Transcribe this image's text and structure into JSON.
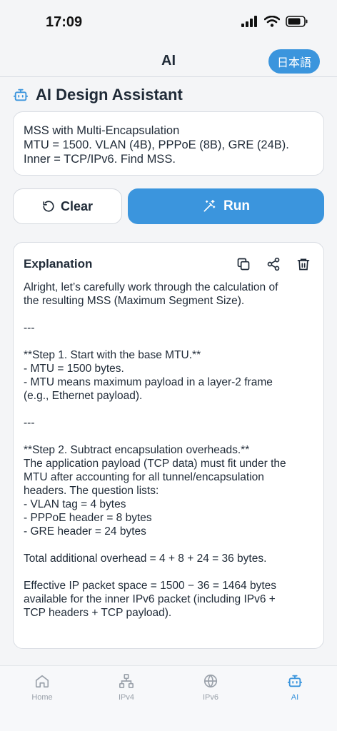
{
  "status": {
    "time": "17:09"
  },
  "nav": {
    "title": "AI",
    "lang_button": "日本語"
  },
  "section": {
    "title": "AI Design Assistant"
  },
  "prompt": {
    "lines": [
      "MSS with Multi-Encapsulation",
      "MTU = 1500. VLAN (4B), PPPoE (8B), GRE (24B).",
      "Inner = TCP/IPv6. Find MSS."
    ]
  },
  "actions": {
    "clear_label": "Clear",
    "run_label": "Run"
  },
  "explanation": {
    "title": "Explanation",
    "lines": [
      "Alright, let’s carefully work through the calculation of",
      "the resulting MSS (Maximum Segment Size).",
      "",
      "---",
      "",
      "**Step 1. Start with the base MTU.**",
      "- MTU = 1500 bytes.",
      "- MTU means maximum payload in a layer-2 frame",
      "(e.g., Ethernet payload).",
      "",
      "---",
      "",
      "**Step 2. Subtract encapsulation overheads.**",
      "The application payload (TCP data) must fit under the",
      "MTU after accounting for all tunnel/encapsulation",
      "headers. The question lists:",
      "- VLAN tag = 4 bytes",
      "- PPPoE header = 8 bytes",
      "- GRE header = 24 bytes",
      "",
      "Total additional overhead = 4 + 8 + 24 = 36 bytes.",
      "",
      "Effective IP packet space = 1500 − 36 = 1464 bytes",
      "available for the inner IPv6 packet (including IPv6 +",
      "TCP headers + TCP payload)."
    ]
  },
  "tabs": [
    {
      "label": "Home",
      "icon": "home-icon"
    },
    {
      "label": "IPv4",
      "icon": "network-icon"
    },
    {
      "label": "IPv6",
      "icon": "globe-icon"
    },
    {
      "label": "AI",
      "icon": "robot-icon",
      "active": true
    }
  ],
  "colors": {
    "accent": "#3b95dd",
    "text": "#1f2a37",
    "muted": "#9aa1aa"
  }
}
